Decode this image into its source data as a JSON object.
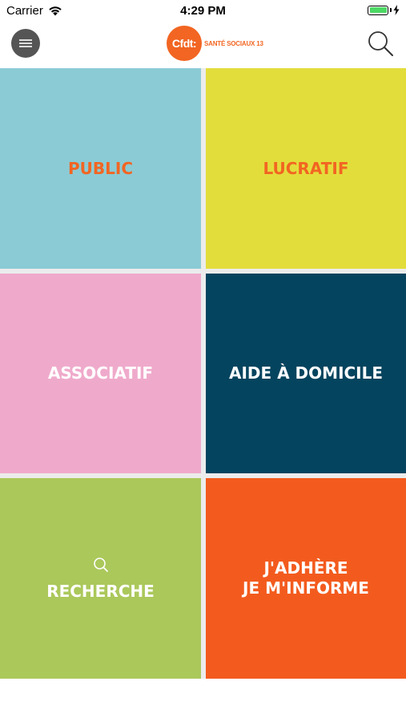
{
  "status_bar": {
    "carrier": "Carrier",
    "time": "4:29 PM",
    "battery_level": 1.0,
    "battery_color": "#4cd964"
  },
  "header": {
    "menu_icon": "hamburger-menu-icon",
    "logo_text": "Cfdt:",
    "logo_subtitle": "SANTÉ SOCIAUX 13",
    "logo_color": "#f26522",
    "search_icon": "search-icon"
  },
  "tiles": [
    {
      "label": "PUBLIC",
      "background": "#8bcbd5",
      "text_color": "#f26522"
    },
    {
      "label": "LUCRATIF",
      "background": "#e3dd3c",
      "text_color": "#f26522"
    },
    {
      "label": "ASSOCIATIF",
      "background": "#efaacb",
      "text_color": "#ffffff"
    },
    {
      "label": "AIDE À DOMICILE",
      "background": "#04445e",
      "text_color": "#ffffff"
    },
    {
      "label": "RECHERCHE",
      "background": "#abc85b",
      "text_color": "#ffffff",
      "icon": "search-icon"
    },
    {
      "label": "J'ADHÈRE\nJE M'INFORME",
      "background": "#f35b1e",
      "text_color": "#ffffff"
    }
  ]
}
